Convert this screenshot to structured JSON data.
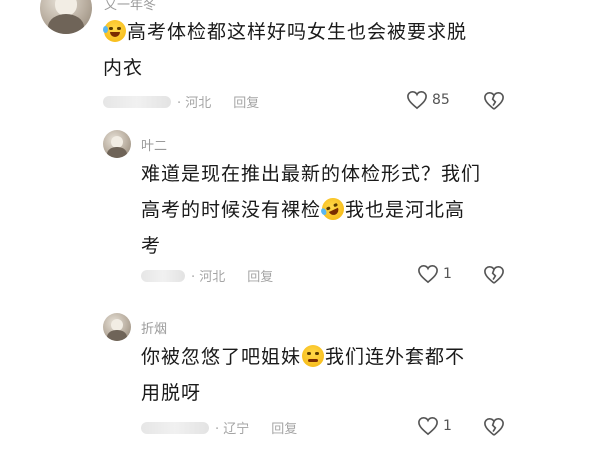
{
  "comments": [
    {
      "username": "又一年冬",
      "text_parts": [
        "",
        "高考体检都这样好吗女生也会被要求脱",
        "内衣"
      ],
      "region": "· 河北",
      "reply_label": "回复",
      "likes": "85"
    },
    {
      "username": "叶二",
      "lines": [
        "难道是现在推出最新的体检形式？我们",
        "高考的时候没有裸检",
        "我也是河北高",
        "考"
      ],
      "region": "· 河北",
      "reply_label": "回复",
      "likes": "1"
    },
    {
      "username": "折烟",
      "lines": [
        "你被忽悠了吧姐妹",
        "我们连外套都不",
        "用脱呀"
      ],
      "region": "· 辽宁",
      "reply_label": "回复",
      "likes": "1"
    }
  ],
  "icons": {
    "like": "heart-outline-icon",
    "dislike": "broken-heart-icon",
    "emoji_1": "laughing-with-tears-emoji",
    "emoji_2": "rolling-laughing-emoji",
    "emoji_3": "pleading-face-emoji"
  }
}
